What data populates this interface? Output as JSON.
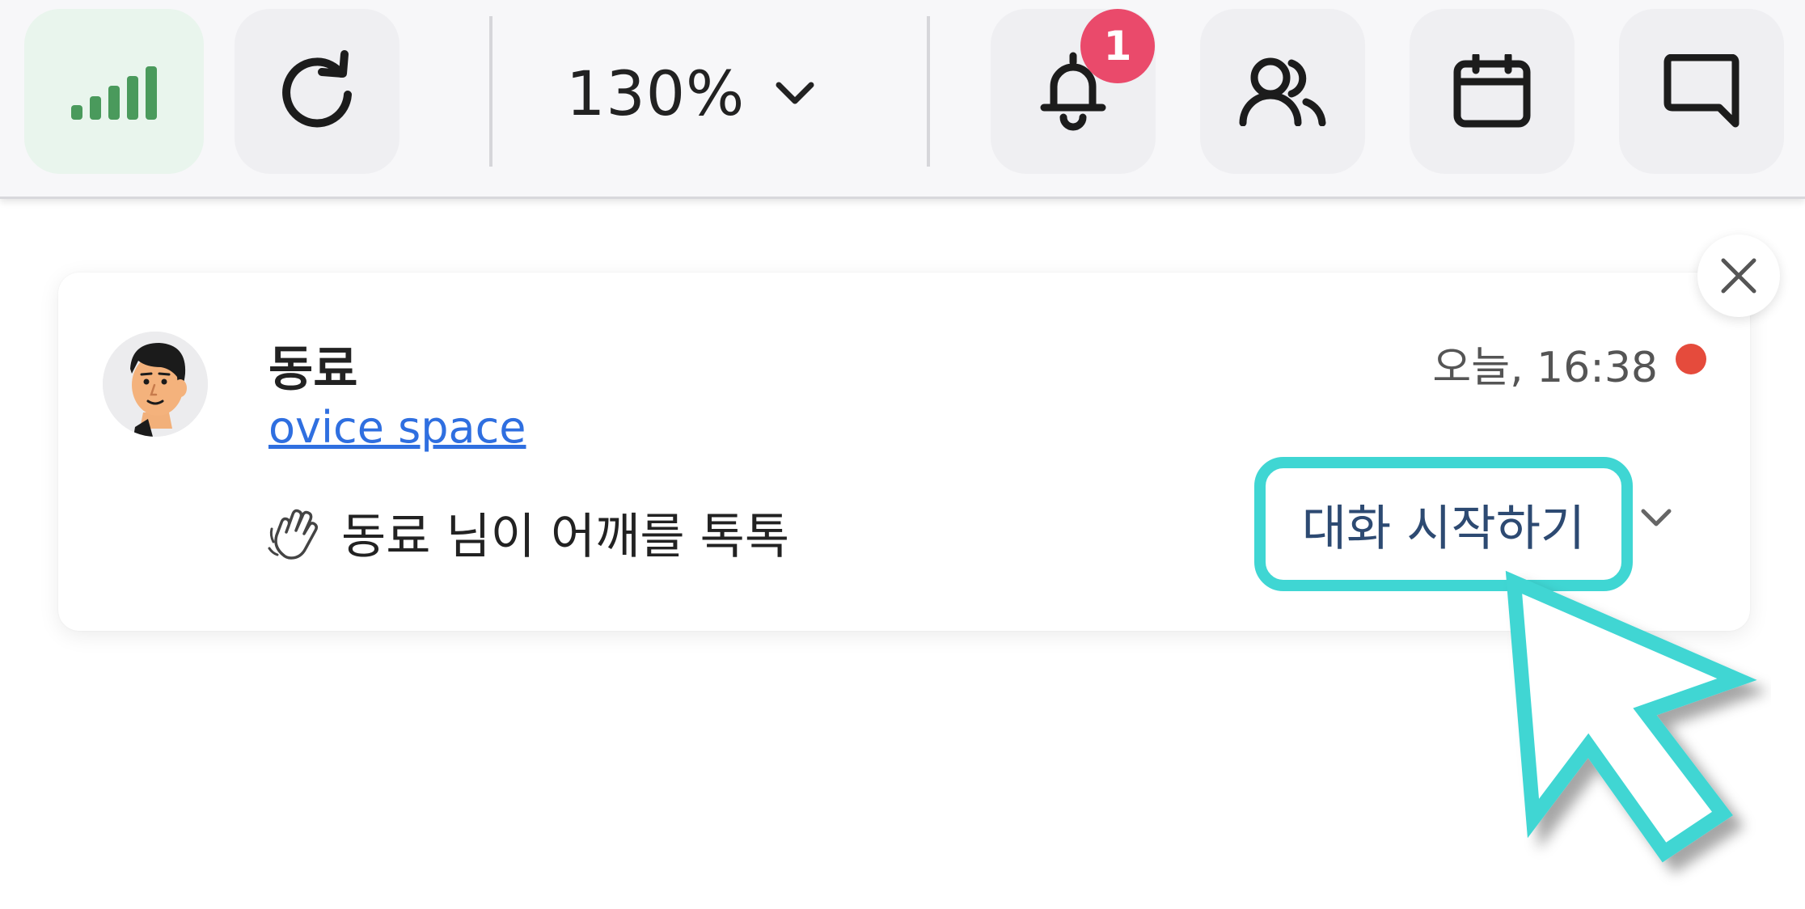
{
  "toolbar": {
    "signal": {
      "icon": "signal-bars-icon",
      "color": "#4a9a5c"
    },
    "reload": {
      "icon": "reload-icon"
    },
    "zoom": {
      "value": "130%",
      "icon": "chevron-down-icon"
    },
    "notifications": {
      "icon": "bell-icon",
      "badge_count": "1",
      "badge_color": "#ea4a6b"
    },
    "people": {
      "icon": "people-icon"
    },
    "calendar": {
      "icon": "calendar-icon"
    },
    "chat": {
      "icon": "chat-bubble-icon"
    }
  },
  "notification": {
    "sender_name": "동료",
    "space_link": "ovice space",
    "time": "오늘, 16:38",
    "unread_color": "#e54b3c",
    "message_icon": "waving-hand-icon",
    "message": "동료 님이 어깨를 톡톡",
    "action_label": "대화 시작하기",
    "action_menu_icon": "chevron-down-icon",
    "close_icon": "close-icon",
    "highlight_color": "#3fd6d3"
  }
}
